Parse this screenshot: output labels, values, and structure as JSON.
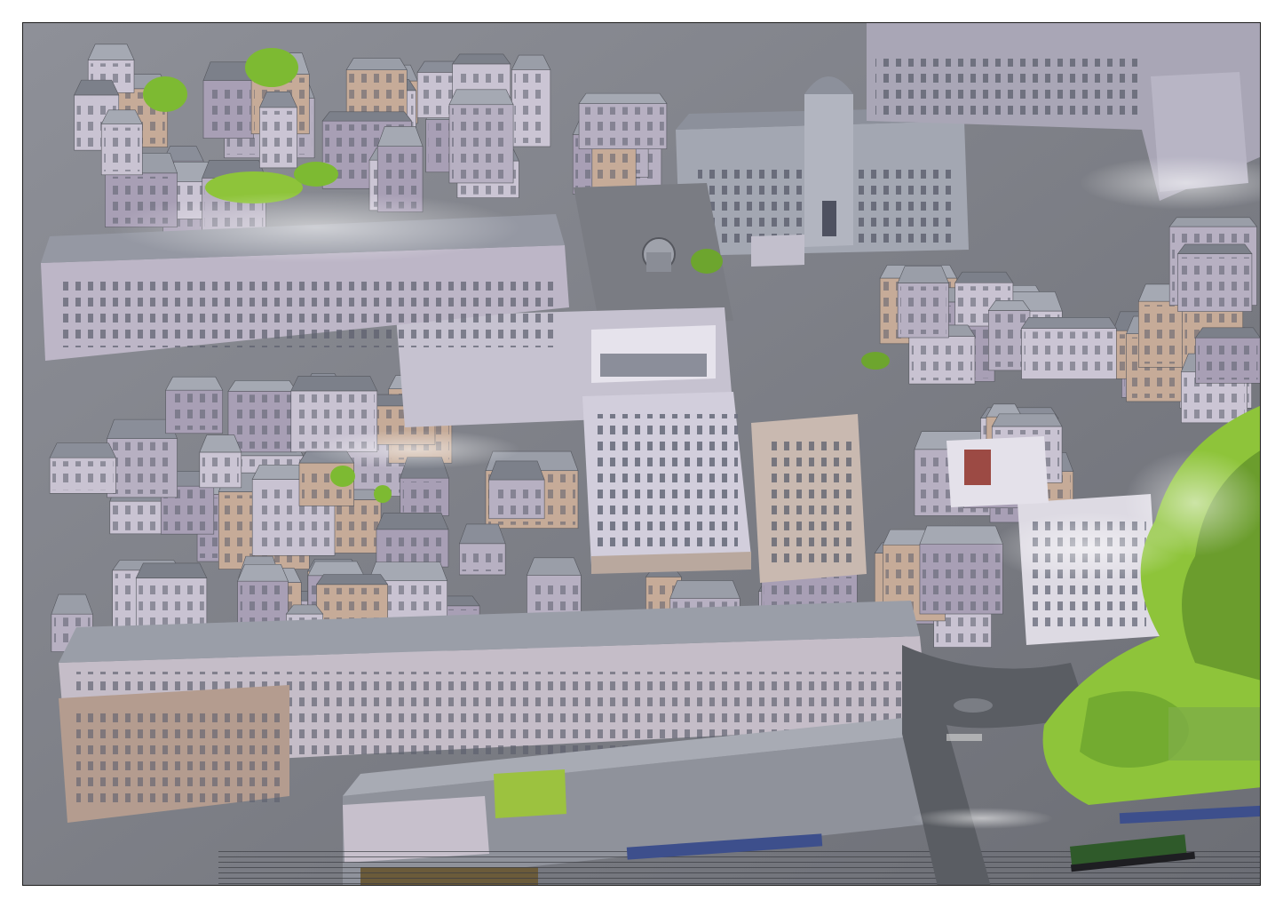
{
  "artwork": {
    "subject": "",
    "palette": {
      "ground": "#6f7178",
      "roof": "#9a9ea8",
      "roof_dark": "#7c808a",
      "wall_light": "#c9c3d2",
      "wall_shade": "#a89fb5",
      "sandstone": "#c6ab98",
      "window": "#5c5f6d",
      "tree": "#8ec43a",
      "tree_dark": "#4e7e22",
      "road": "#5a5d63",
      "train": "#3d4f8c",
      "locomotive": "#2f5a2a",
      "green_roof": "#9cc23f",
      "mist": "#ffffff"
    },
    "frame_color": "#1e1e1e",
    "paper_color": "#ffffff"
  }
}
